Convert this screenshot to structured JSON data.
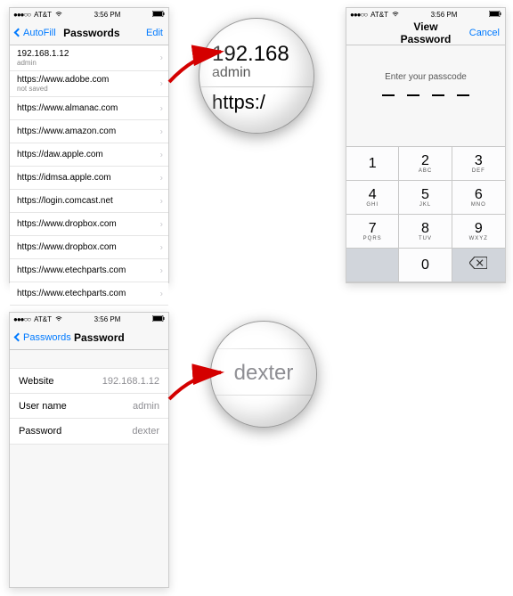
{
  "status": {
    "carrier": "AT&T",
    "time": "3:56 PM"
  },
  "screen1": {
    "back": "AutoFill",
    "title": "Passwords",
    "action": "Edit",
    "rows": [
      {
        "site": "192.168.1.12",
        "sub": "admin"
      },
      {
        "site": "https://www.adobe.com",
        "sub": "not saved"
      },
      {
        "site": "https://www.almanac.com"
      },
      {
        "site": "https://www.amazon.com"
      },
      {
        "site": "https://daw.apple.com"
      },
      {
        "site": "https://idmsa.apple.com"
      },
      {
        "site": "https://login.comcast.net"
      },
      {
        "site": "https://www.dropbox.com"
      },
      {
        "site": "https://www.dropbox.com"
      },
      {
        "site": "https://www.etechparts.com"
      },
      {
        "site": "https://www.etechparts.com"
      }
    ]
  },
  "screen2": {
    "title": "View Password",
    "action": "Cancel",
    "prompt": "Enter your passcode",
    "keys": [
      {
        "n": "1",
        "l": ""
      },
      {
        "n": "2",
        "l": "ABC"
      },
      {
        "n": "3",
        "l": "DEF"
      },
      {
        "n": "4",
        "l": "GHI"
      },
      {
        "n": "5",
        "l": "JKL"
      },
      {
        "n": "6",
        "l": "MNO"
      },
      {
        "n": "7",
        "l": "PQRS"
      },
      {
        "n": "8",
        "l": "TUV"
      },
      {
        "n": "9",
        "l": "WXYZ"
      }
    ],
    "zero": "0"
  },
  "screen3": {
    "back": "Passwords",
    "title": "Password",
    "fields": [
      {
        "label": "Website",
        "value": "192.168.1.12"
      },
      {
        "label": "User name",
        "value": "admin"
      },
      {
        "label": "Password",
        "value": "dexter"
      }
    ]
  },
  "lens1": {
    "line1": "192.168",
    "line2": "admin",
    "line3": "https:/"
  },
  "lens2": {
    "text": "dexter"
  }
}
